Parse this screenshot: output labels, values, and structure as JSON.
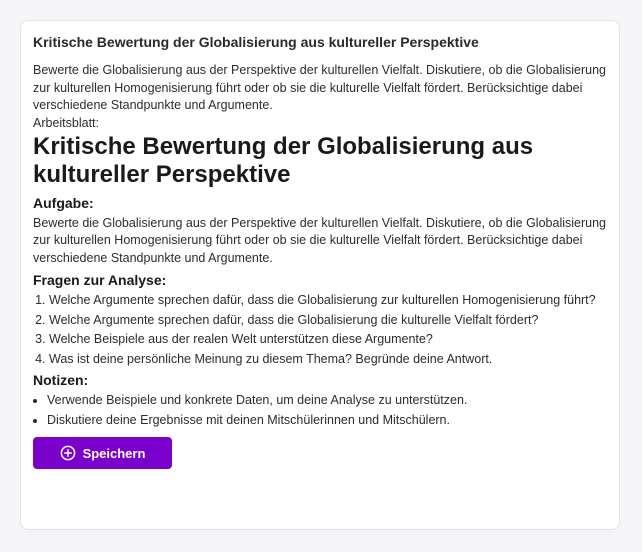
{
  "card": {
    "title": "Kritische Bewertung der Globalisierung aus kultureller Perspektive",
    "intro": "Bewerte die Globalisierung aus der Perspektive der kulturellen Vielfalt. Diskutiere, ob die Globalisierung zur kulturellen Homogenisierung führt oder ob sie die kulturelle Vielfalt fördert. Berücksichtige dabei verschiedene Standpunkte und Argumente."
  },
  "worksheet": {
    "label": "Arbeitsblatt:",
    "title": "Kritische Bewertung der Globalisierung aus kultureller Perspektive",
    "task_heading": "Aufgabe:",
    "task_text": "Bewerte die Globalisierung aus der Perspektive der kulturellen Vielfalt. Diskutiere, ob die Globalisierung zur kulturellen Homogenisierung führt oder ob sie die kulturelle Vielfalt fördert. Berücksichtige dabei verschiedene Standpunkte und Argumente.",
    "questions_heading": "Fragen zur Analyse:",
    "questions": [
      "Welche Argumente sprechen dafür, dass die Globalisierung zur kulturellen Homogenisierung führt?",
      "Welche Argumente sprechen dafür, dass die Globalisierung die kulturelle Vielfalt fördert?",
      "Welche Beispiele aus der realen Welt unterstützen diese Argumente?",
      "Was ist deine persönliche Meinung zu diesem Thema? Begründe deine Antwort."
    ],
    "notes_heading": "Notizen:",
    "notes": [
      "Verwende Beispiele und konkrete Daten, um deine Analyse zu unterstützen.",
      "Diskutiere deine Ergebnisse mit deinen Mitschülerinnen und Mitschülern."
    ]
  },
  "actions": {
    "save_label": "Speichern",
    "save_icon": "plus-circle-icon",
    "accent_color": "#7a00cc"
  }
}
